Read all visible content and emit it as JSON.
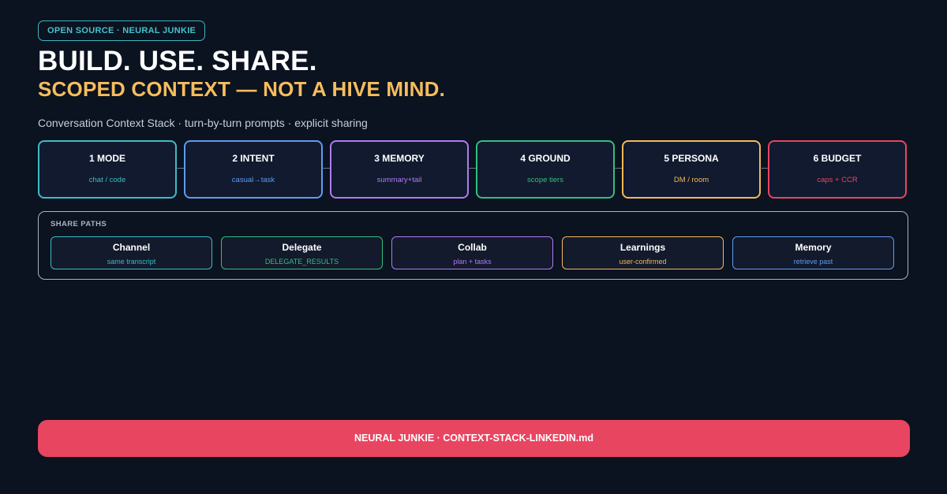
{
  "badge": "OPEN SOURCE · NEURAL JUNKIE",
  "title": "BUILD. USE. SHARE.",
  "subtitle": "SCOPED CONTEXT — NOT A HIVE MIND.",
  "tagline": "Conversation Context Stack · turn-by-turn prompts · explicit sharing",
  "stack": [
    {
      "title": "1 MODE",
      "sub": "chat / code",
      "color": "#3fbcc6"
    },
    {
      "title": "2 INTENT",
      "sub": "casual→task",
      "color": "#5e9cf2"
    },
    {
      "title": "3 MEMORY",
      "sub": "summary+tail",
      "color": "#b27af4"
    },
    {
      "title": "4 GROUND",
      "sub": "scope tiers",
      "color": "#36be7f"
    },
    {
      "title": "5 PERSONA",
      "sub": "DM / room",
      "color": "#f5b95a"
    },
    {
      "title": "6 BUDGET",
      "sub": "caps + CCR",
      "color": "#e8465f"
    }
  ],
  "share": {
    "heading": "SHARE PATHS",
    "paths": [
      {
        "title": "Channel",
        "sub": "same transcript",
        "color": "#3fbcc6"
      },
      {
        "title": "Delegate",
        "sub": "DELEGATE_RESULTS",
        "color": "#36be7f"
      },
      {
        "title": "Collab",
        "sub": "plan + tasks",
        "color": "#b27af4"
      },
      {
        "title": "Learnings",
        "sub": "user-confirmed",
        "color": "#f5b95a"
      },
      {
        "title": "Memory",
        "sub": "retrieve past",
        "color": "#5e9cf2"
      }
    ]
  },
  "footer": "NEURAL JUNKIE · CONTEXT-STACK-LINKEDIN.md",
  "colors": {
    "background": "#0b1220",
    "accent": "#f6bd5e",
    "footer": "#e84561"
  }
}
